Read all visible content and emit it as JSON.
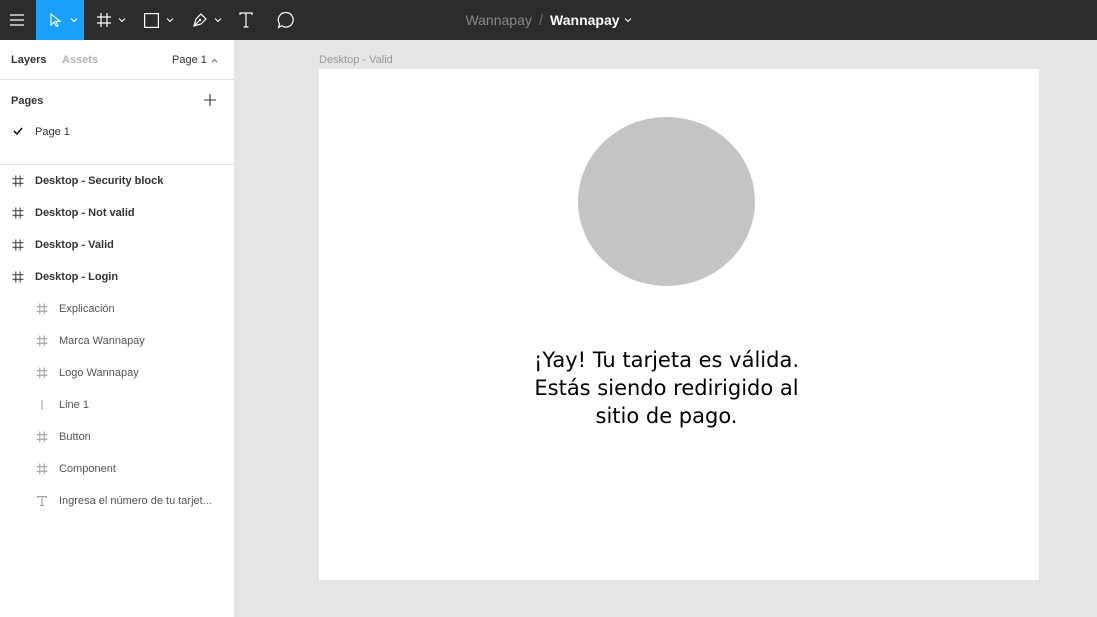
{
  "toolbar": {
    "menu_icon": "hamburger-menu-icon",
    "tools": [
      {
        "icon": "move-tool-icon",
        "active": true
      },
      {
        "icon": "frame-tool-icon"
      },
      {
        "icon": "shape-tool-icon"
      },
      {
        "icon": "pen-tool-icon"
      },
      {
        "icon": "text-tool-icon"
      },
      {
        "icon": "comment-tool-icon"
      }
    ],
    "project_name": "Wannapay",
    "separator": "/",
    "file_name": "Wannapay",
    "accent_color": "#18a0fb"
  },
  "panel": {
    "tabs": {
      "layers": "Layers",
      "assets": "Assets"
    },
    "current_page": "Page 1",
    "pages_header": "Pages",
    "pages": [
      {
        "label": "Page 1",
        "selected": true
      }
    ],
    "layers": [
      {
        "label": "Desktop - Security block",
        "icon": "frame-icon"
      },
      {
        "label": "Desktop - Not valid",
        "icon": "frame-icon"
      },
      {
        "label": "Desktop - Valid",
        "icon": "frame-icon"
      },
      {
        "label": "Desktop - Login",
        "icon": "frame-icon"
      }
    ],
    "children": [
      {
        "label": "Explicación",
        "icon": "frame-icon"
      },
      {
        "label": "Marca Wannapay",
        "icon": "frame-icon"
      },
      {
        "label": "Logo Wannapay",
        "icon": "frame-icon"
      },
      {
        "label": "Line 1",
        "icon": "line-icon"
      },
      {
        "label": "Button",
        "icon": "frame-icon"
      },
      {
        "label": "Component",
        "icon": "frame-icon"
      },
      {
        "label": "Ingresa el número de tu tarjet...",
        "icon": "text-icon"
      }
    ]
  },
  "canvas": {
    "frame_label": "Desktop - Valid",
    "frame_text": "¡Yay! Tu tarjeta es válida.\nEstás siendo redirigido al\nsitio de pago.",
    "circle_color": "#c4c4c4"
  }
}
